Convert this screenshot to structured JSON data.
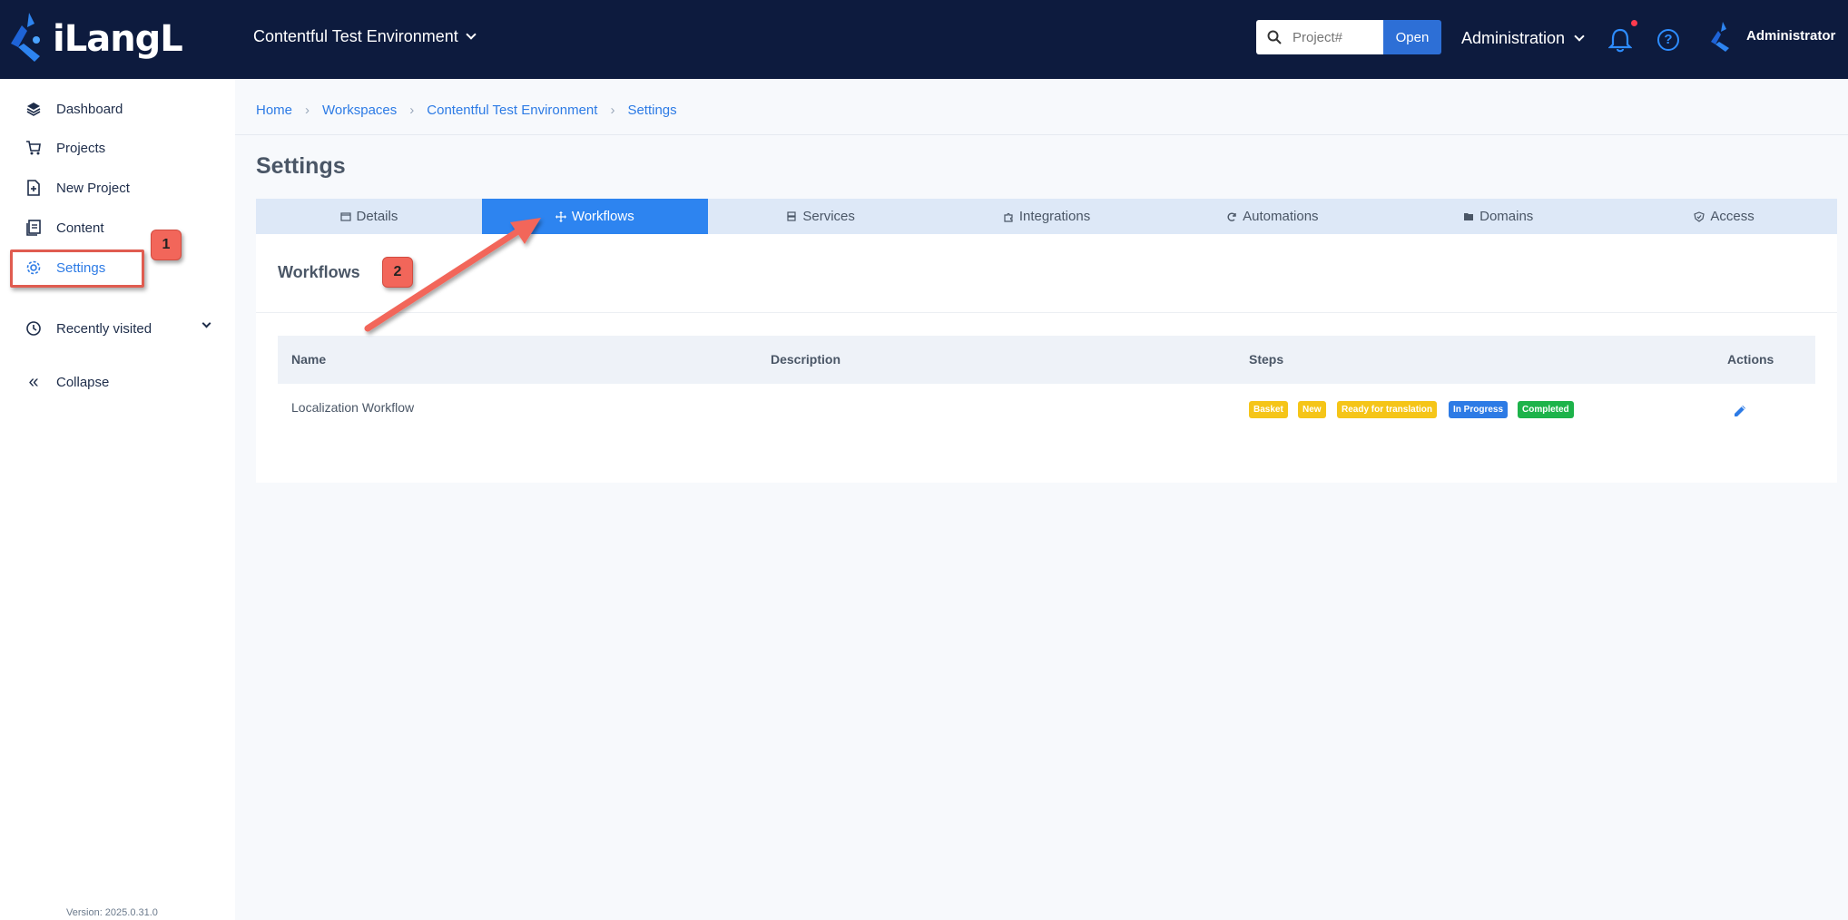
{
  "header": {
    "logo_text": "iLangL",
    "environment": "Contentful Test Environment",
    "search_placeholder": "Project#",
    "open_label": "Open",
    "admin_menu": "Administration",
    "user_name": "Administrator",
    "help_label": "?"
  },
  "sidebar": {
    "items": [
      {
        "label": "Dashboard",
        "icon": "layers-icon"
      },
      {
        "label": "Projects",
        "icon": "cart-icon"
      },
      {
        "label": "New Project",
        "icon": "file-plus-icon"
      },
      {
        "label": "Content",
        "icon": "documents-icon"
      },
      {
        "label": "Settings",
        "icon": "gear-icon"
      },
      {
        "label": "Recently visited",
        "icon": "clock-icon"
      },
      {
        "label": "Collapse",
        "icon": "double-chevron-left-icon"
      }
    ],
    "active": "Settings",
    "version": "Version: 2025.0.31.0"
  },
  "breadcrumb": [
    "Home",
    "Workspaces",
    "Contentful Test Environment",
    "Settings"
  ],
  "page_title": "Settings",
  "tabs": [
    {
      "label": "Details",
      "icon": "window-icon"
    },
    {
      "label": "Workflows",
      "icon": "move-icon"
    },
    {
      "label": "Services",
      "icon": "server-icon"
    },
    {
      "label": "Integrations",
      "icon": "puzzle-icon"
    },
    {
      "label": "Automations",
      "icon": "refresh-icon"
    },
    {
      "label": "Domains",
      "icon": "folder-icon"
    },
    {
      "label": "Access",
      "icon": "shield-check-icon"
    }
  ],
  "active_tab": "Workflows",
  "workflows": {
    "title": "Workflows",
    "columns": [
      "Name",
      "Description",
      "Steps",
      "Actions"
    ],
    "rows": [
      {
        "name": "Localization Workflow",
        "description": "",
        "steps": [
          {
            "label": "Basket",
            "color": "#f5c518"
          },
          {
            "label": "New",
            "color": "#f5c518"
          },
          {
            "label": "Ready for translation",
            "color": "#f5c518"
          },
          {
            "label": "In Progress",
            "color": "#2d7be5"
          },
          {
            "label": "Completed",
            "color": "#1db34a"
          }
        ]
      }
    ]
  },
  "annotations": {
    "callout_1": "1",
    "callout_2": "2"
  },
  "colors": {
    "topbar": "#0d1b3e",
    "accent": "#2d84f0",
    "annotation": "#f2665a"
  }
}
